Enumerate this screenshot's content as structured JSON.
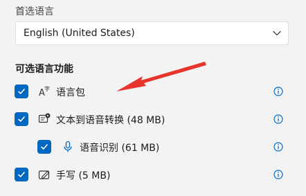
{
  "preferred_language": {
    "label": "首选语言",
    "selected": "English (United States)"
  },
  "optional_features": {
    "heading": "可选语言功能",
    "items": [
      {
        "label": "语言包",
        "checked": true,
        "icon": "language-icon"
      },
      {
        "label": "文本到语音转换 (48 MB)",
        "checked": true,
        "icon": "text-to-speech-icon"
      },
      {
        "label": "语音识别 (61 MB)",
        "checked": true,
        "icon": "microphone-icon"
      },
      {
        "label": "手写 (5 MB)",
        "checked": true,
        "icon": "handwriting-icon"
      }
    ]
  },
  "colors": {
    "accent": "#0067c0",
    "annotation_arrow": "#e8352c",
    "background": "#f3f3f3"
  }
}
